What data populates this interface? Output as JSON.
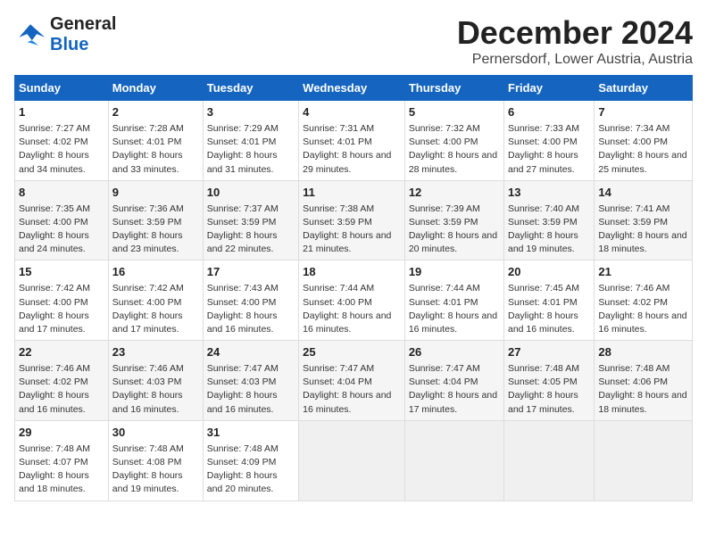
{
  "logo": {
    "text_general": "General",
    "text_blue": "Blue"
  },
  "title": "December 2024",
  "subtitle": "Pernersdorf, Lower Austria, Austria",
  "days_header": [
    "Sunday",
    "Monday",
    "Tuesday",
    "Wednesday",
    "Thursday",
    "Friday",
    "Saturday"
  ],
  "weeks": [
    [
      {
        "day": 1,
        "sunrise": "Sunrise: 7:27 AM",
        "sunset": "Sunset: 4:02 PM",
        "daylight": "Daylight: 8 hours and 34 minutes."
      },
      {
        "day": 2,
        "sunrise": "Sunrise: 7:28 AM",
        "sunset": "Sunset: 4:01 PM",
        "daylight": "Daylight: 8 hours and 33 minutes."
      },
      {
        "day": 3,
        "sunrise": "Sunrise: 7:29 AM",
        "sunset": "Sunset: 4:01 PM",
        "daylight": "Daylight: 8 hours and 31 minutes."
      },
      {
        "day": 4,
        "sunrise": "Sunrise: 7:31 AM",
        "sunset": "Sunset: 4:01 PM",
        "daylight": "Daylight: 8 hours and 29 minutes."
      },
      {
        "day": 5,
        "sunrise": "Sunrise: 7:32 AM",
        "sunset": "Sunset: 4:00 PM",
        "daylight": "Daylight: 8 hours and 28 minutes."
      },
      {
        "day": 6,
        "sunrise": "Sunrise: 7:33 AM",
        "sunset": "Sunset: 4:00 PM",
        "daylight": "Daylight: 8 hours and 27 minutes."
      },
      {
        "day": 7,
        "sunrise": "Sunrise: 7:34 AM",
        "sunset": "Sunset: 4:00 PM",
        "daylight": "Daylight: 8 hours and 25 minutes."
      }
    ],
    [
      {
        "day": 8,
        "sunrise": "Sunrise: 7:35 AM",
        "sunset": "Sunset: 4:00 PM",
        "daylight": "Daylight: 8 hours and 24 minutes."
      },
      {
        "day": 9,
        "sunrise": "Sunrise: 7:36 AM",
        "sunset": "Sunset: 3:59 PM",
        "daylight": "Daylight: 8 hours and 23 minutes."
      },
      {
        "day": 10,
        "sunrise": "Sunrise: 7:37 AM",
        "sunset": "Sunset: 3:59 PM",
        "daylight": "Daylight: 8 hours and 22 minutes."
      },
      {
        "day": 11,
        "sunrise": "Sunrise: 7:38 AM",
        "sunset": "Sunset: 3:59 PM",
        "daylight": "Daylight: 8 hours and 21 minutes."
      },
      {
        "day": 12,
        "sunrise": "Sunrise: 7:39 AM",
        "sunset": "Sunset: 3:59 PM",
        "daylight": "Daylight: 8 hours and 20 minutes."
      },
      {
        "day": 13,
        "sunrise": "Sunrise: 7:40 AM",
        "sunset": "Sunset: 3:59 PM",
        "daylight": "Daylight: 8 hours and 19 minutes."
      },
      {
        "day": 14,
        "sunrise": "Sunrise: 7:41 AM",
        "sunset": "Sunset: 3:59 PM",
        "daylight": "Daylight: 8 hours and 18 minutes."
      }
    ],
    [
      {
        "day": 15,
        "sunrise": "Sunrise: 7:42 AM",
        "sunset": "Sunset: 4:00 PM",
        "daylight": "Daylight: 8 hours and 17 minutes."
      },
      {
        "day": 16,
        "sunrise": "Sunrise: 7:42 AM",
        "sunset": "Sunset: 4:00 PM",
        "daylight": "Daylight: 8 hours and 17 minutes."
      },
      {
        "day": 17,
        "sunrise": "Sunrise: 7:43 AM",
        "sunset": "Sunset: 4:00 PM",
        "daylight": "Daylight: 8 hours and 16 minutes."
      },
      {
        "day": 18,
        "sunrise": "Sunrise: 7:44 AM",
        "sunset": "Sunset: 4:00 PM",
        "daylight": "Daylight: 8 hours and 16 minutes."
      },
      {
        "day": 19,
        "sunrise": "Sunrise: 7:44 AM",
        "sunset": "Sunset: 4:01 PM",
        "daylight": "Daylight: 8 hours and 16 minutes."
      },
      {
        "day": 20,
        "sunrise": "Sunrise: 7:45 AM",
        "sunset": "Sunset: 4:01 PM",
        "daylight": "Daylight: 8 hours and 16 minutes."
      },
      {
        "day": 21,
        "sunrise": "Sunrise: 7:46 AM",
        "sunset": "Sunset: 4:02 PM",
        "daylight": "Daylight: 8 hours and 16 minutes."
      }
    ],
    [
      {
        "day": 22,
        "sunrise": "Sunrise: 7:46 AM",
        "sunset": "Sunset: 4:02 PM",
        "daylight": "Daylight: 8 hours and 16 minutes."
      },
      {
        "day": 23,
        "sunrise": "Sunrise: 7:46 AM",
        "sunset": "Sunset: 4:03 PM",
        "daylight": "Daylight: 8 hours and 16 minutes."
      },
      {
        "day": 24,
        "sunrise": "Sunrise: 7:47 AM",
        "sunset": "Sunset: 4:03 PM",
        "daylight": "Daylight: 8 hours and 16 minutes."
      },
      {
        "day": 25,
        "sunrise": "Sunrise: 7:47 AM",
        "sunset": "Sunset: 4:04 PM",
        "daylight": "Daylight: 8 hours and 16 minutes."
      },
      {
        "day": 26,
        "sunrise": "Sunrise: 7:47 AM",
        "sunset": "Sunset: 4:04 PM",
        "daylight": "Daylight: 8 hours and 17 minutes."
      },
      {
        "day": 27,
        "sunrise": "Sunrise: 7:48 AM",
        "sunset": "Sunset: 4:05 PM",
        "daylight": "Daylight: 8 hours and 17 minutes."
      },
      {
        "day": 28,
        "sunrise": "Sunrise: 7:48 AM",
        "sunset": "Sunset: 4:06 PM",
        "daylight": "Daylight: 8 hours and 18 minutes."
      }
    ],
    [
      {
        "day": 29,
        "sunrise": "Sunrise: 7:48 AM",
        "sunset": "Sunset: 4:07 PM",
        "daylight": "Daylight: 8 hours and 18 minutes."
      },
      {
        "day": 30,
        "sunrise": "Sunrise: 7:48 AM",
        "sunset": "Sunset: 4:08 PM",
        "daylight": "Daylight: 8 hours and 19 minutes."
      },
      {
        "day": 31,
        "sunrise": "Sunrise: 7:48 AM",
        "sunset": "Sunset: 4:09 PM",
        "daylight": "Daylight: 8 hours and 20 minutes."
      },
      null,
      null,
      null,
      null
    ]
  ]
}
